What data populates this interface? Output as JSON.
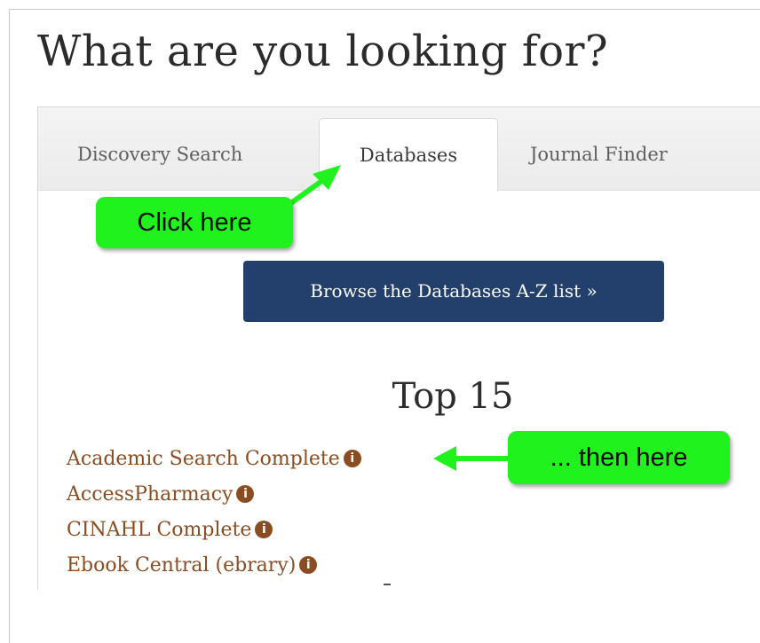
{
  "heading": {
    "title": "What are you looking for?"
  },
  "tabs": [
    {
      "label": "Discovery Search",
      "active": false
    },
    {
      "label": "Databases",
      "active": true
    },
    {
      "label": "Journal Finder",
      "active": false
    }
  ],
  "browse_button": {
    "label": "Browse the Databases A-Z list »"
  },
  "top_list": {
    "title": "Top 15",
    "items": [
      {
        "label": "Academic Search Complete"
      },
      {
        "label": "AccessPharmacy"
      },
      {
        "label": "CINAHL Complete"
      },
      {
        "label": "Ebook Central (ebrary)"
      }
    ]
  },
  "annotations": {
    "callout_1": "Click here",
    "callout_2": "... then here",
    "color": "#1ff21c"
  },
  "colors": {
    "button_bg": "#233f6b",
    "link": "#8a4d22",
    "title_text": "#2b2b2b"
  },
  "icons": {
    "info": "info-circle-icon",
    "info_glyph": "i"
  }
}
